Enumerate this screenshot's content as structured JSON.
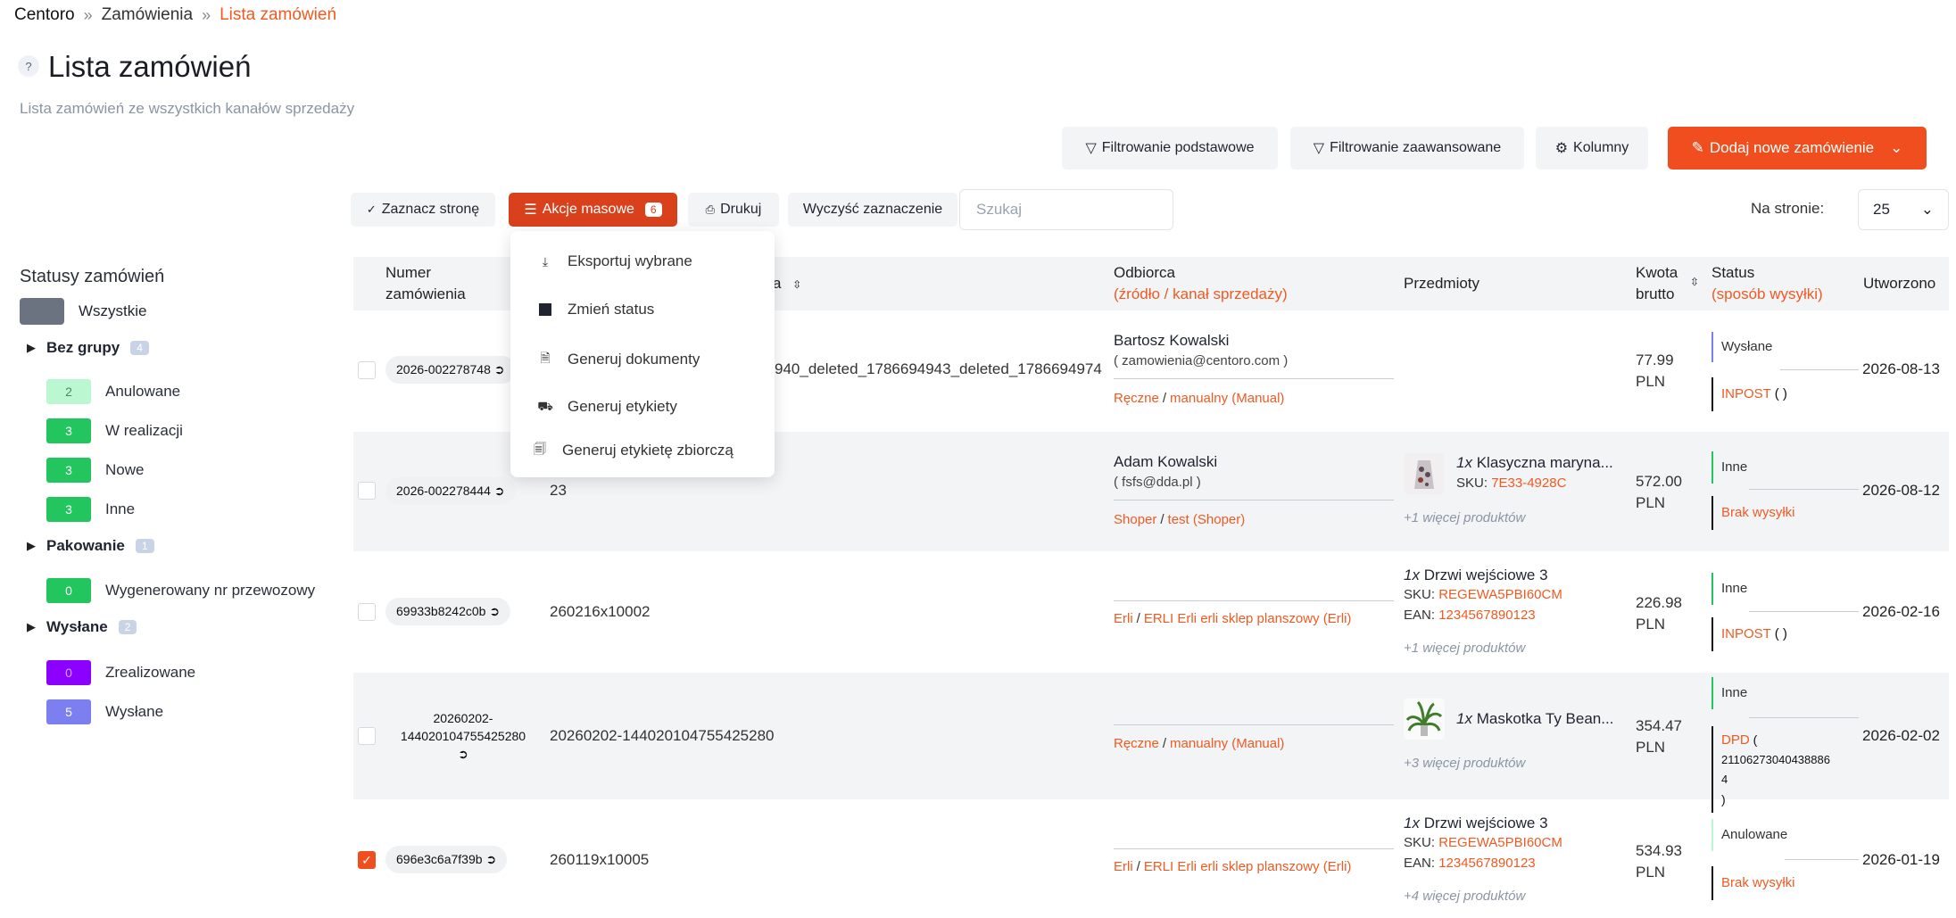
{
  "breadcrumb": [
    "Centoro",
    "Zamówienia",
    "Lista zamówień"
  ],
  "page": {
    "help": "?",
    "title": "Lista zamówień",
    "subtitle": "Lista zamówień ze wszystkich kanałów sprzedaży"
  },
  "toolbar_top": {
    "basic_filter": "Filtrowanie podstawowe",
    "advanced_filter": "Filtrowanie zaawansowane",
    "columns": "Kolumny",
    "add_order": "Dodaj nowe zamówienie"
  },
  "toolbar": {
    "select_page": "Zaznacz stronę",
    "bulk_actions": "Akcje masowe",
    "bulk_count": "6",
    "print": "Drukuj",
    "clear_selection": "Wyczyść zaznaczenie",
    "search_placeholder": "Szukaj",
    "per_page_label": "Na stronie:",
    "per_page_value": "25"
  },
  "bulk_menu": [
    {
      "label": "Eksportuj wybrane",
      "icon": "download-icon"
    },
    {
      "label": "Zmień status",
      "icon": "square-icon"
    },
    {
      "label": "Generuj dokumenty",
      "icon": "document-icon"
    },
    {
      "label": "Generuj etykiety",
      "icon": "truck-icon"
    },
    {
      "label": "Generuj etykietę zbiorczą",
      "icon": "documents-icon"
    }
  ],
  "sidebar": {
    "title": "Statusy zamówień",
    "all": "Wszystkie",
    "groups": [
      {
        "name": "Bez grupy",
        "count": "4",
        "statuses": [
          {
            "count": "2",
            "label": "Anulowane",
            "color": "#bbf7d0"
          },
          {
            "count": "3",
            "label": "W realizacji",
            "color": "#22c55e"
          },
          {
            "count": "3",
            "label": "Nowe",
            "color": "#22c55e"
          },
          {
            "count": "3",
            "label": "Inne",
            "color": "#22c55e"
          }
        ]
      },
      {
        "name": "Pakowanie",
        "count": "1",
        "statuses": [
          {
            "count": "0",
            "label": "Wygenerowany nr przewozowy",
            "color": "#22c55e"
          }
        ]
      },
      {
        "name": "Wysłane",
        "count": "2",
        "statuses": [
          {
            "count": "0",
            "label": "Zrealizowane",
            "color": "#8b00ff"
          },
          {
            "count": "5",
            "label": "Wysłane",
            "color": "#7b7ff0"
          }
        ]
      }
    ]
  },
  "table": {
    "headers": {
      "number_l1": "Numer",
      "number_l2": "zamówienia",
      "external_suffix": "a",
      "recipient": "Odbiorca",
      "recipient_sub": "(źródło / kanał sprzedaży)",
      "items": "Przedmioty",
      "amount_l1": "Kwota",
      "amount_l2": "brutto",
      "status": "Status",
      "status_sub": "(sposób wysyłki)",
      "created": "Utworzono"
    },
    "rows": [
      {
        "number": "2026-002278748",
        "external": "940_deleted_1786694943_deleted_1786694974",
        "name": "Bartosz Kowalski",
        "email": "( zamowienia@centoro.com )",
        "src_a": "Ręczne",
        "src_b": "manualny (Manual)",
        "amount": "77.99",
        "currency": "PLN",
        "status": "Wysłane",
        "ship": "INPOST",
        "ship_detail": "( )",
        "date": "2026-08-13"
      },
      {
        "number": "2026-002278444",
        "external": "23",
        "name": "Adam Kowalski",
        "email": "( fsfs@dda.pl )",
        "src_a": "Shoper",
        "src_b": "test (Shoper)",
        "item_qty": "1x",
        "item_name": "Klasyczna maryna...",
        "sku_label": "SKU:",
        "sku": "7E33-4928C",
        "more": "+1 więcej produktów",
        "amount": "572.00",
        "currency": "PLN",
        "status": "Inne",
        "ship": "Brak wysyłki",
        "date": "2026-08-12"
      },
      {
        "number": "69933b8242c0b",
        "external": "260216x10002",
        "src_a": "Erli",
        "src_b": "ERLI Erli erli sklep planszowy (Erli)",
        "item_qty": "1x",
        "item_name": "Drzwi wejściowe 3",
        "sku_label": "SKU:",
        "sku": "REGEWA5PBI60CM",
        "ean_label": "EAN:",
        "ean": "1234567890123",
        "more": "+1 więcej produktów",
        "amount": "226.98",
        "currency": "PLN",
        "status": "Inne",
        "ship": "INPOST",
        "ship_detail": "( )",
        "date": "2026-02-16"
      },
      {
        "number_l1": "20260202-",
        "number_l2": "144020104755425280",
        "external": "20260202-144020104755425280",
        "src_a": "Ręczne",
        "src_b": "manualny (Manual)",
        "item_qty": "1x",
        "item_name": "Maskotka Ty Bean...",
        "more": "+3 więcej produktów",
        "amount": "354.47",
        "currency": "PLN",
        "status": "Inne",
        "ship": "DPD",
        "ship_detail_1": "(",
        "ship_detail_2": "21106273040438886 4",
        "ship_detail_3": ")",
        "date": "2026-02-02"
      },
      {
        "number": "696e3c6a7f39b",
        "external": "260119x10005",
        "src_a": "Erli",
        "src_b": "ERLI Erli erli sklep planszowy (Erli)",
        "item_qty": "1x",
        "item_name": "Drzwi wejściowe 3",
        "sku_label": "SKU:",
        "sku": "REGEWA5PBI60CM",
        "ean_label": "EAN:",
        "ean": "1234567890123",
        "more": "+4 więcej produktów",
        "amount": "534.93",
        "currency": "PLN",
        "status": "Anulowane",
        "ship": "Brak wysyłki",
        "date": "2026-01-19",
        "checked": true
      }
    ]
  },
  "colors": {
    "accent": "#f05a22",
    "button": "#f04e1f",
    "bulk": "#d9411c"
  }
}
